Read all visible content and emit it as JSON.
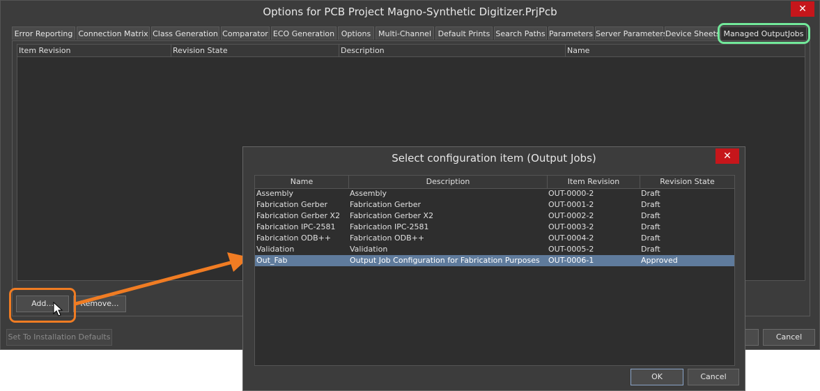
{
  "main_window": {
    "title": "Options for PCB Project Magno-Synthetic Digitizer.PrjPcb",
    "close_label": "✕",
    "tabs": [
      {
        "label": "Error Reporting"
      },
      {
        "label": "Connection Matrix"
      },
      {
        "label": "Class Generation"
      },
      {
        "label": "Comparator"
      },
      {
        "label": "ECO Generation"
      },
      {
        "label": "Options"
      },
      {
        "label": "Multi-Channel"
      },
      {
        "label": "Default Prints"
      },
      {
        "label": "Search Paths"
      },
      {
        "label": "Parameters"
      },
      {
        "label": "Server Parameters"
      },
      {
        "label": "Device Sheets"
      },
      {
        "label": "Managed OutputJobs"
      }
    ],
    "active_tab": "Managed OutputJobs",
    "grid_columns": [
      "Item Revision",
      "Revision State",
      "Description",
      "Name"
    ],
    "add_button": "Add...",
    "remove_button": "Remove...",
    "defaults_button": "Set To Installation Defaults",
    "cancel_button": "Cancel"
  },
  "dialog": {
    "title": "Select configuration item (Output Jobs)",
    "close_label": "✕",
    "columns": [
      "Name",
      "Description",
      "Item Revision",
      "Revision State"
    ],
    "rows": [
      {
        "name": "Assembly",
        "description": "Assembly",
        "revision": "OUT-0000-2",
        "state": "Draft"
      },
      {
        "name": "Fabrication Gerber",
        "description": "Fabrication Gerber",
        "revision": "OUT-0001-2",
        "state": "Draft"
      },
      {
        "name": "Fabrication Gerber X2",
        "description": "Fabrication Gerber X2",
        "revision": "OUT-0002-2",
        "state": "Draft"
      },
      {
        "name": "Fabrication IPC-2581",
        "description": "Fabrication IPC-2581",
        "revision": "OUT-0003-2",
        "state": "Draft"
      },
      {
        "name": "Fabrication ODB++",
        "description": "Fabrication ODB++",
        "revision": "OUT-0004-2",
        "state": "Draft"
      },
      {
        "name": "Validation",
        "description": "Validation",
        "revision": "OUT-0005-2",
        "state": "Draft"
      },
      {
        "name": "Out_Fab",
        "description": "Output Job Configuration for Fabrication Purposes",
        "revision": "OUT-0006-1",
        "state": "Approved"
      }
    ],
    "selected_row": 6,
    "ok_button": "OK",
    "cancel_button": "Cancel"
  },
  "colors": {
    "highlight_green": "#72e89a",
    "highlight_orange": "#f07c23",
    "selection": "#5f7b9c",
    "close": "#c6161b"
  }
}
